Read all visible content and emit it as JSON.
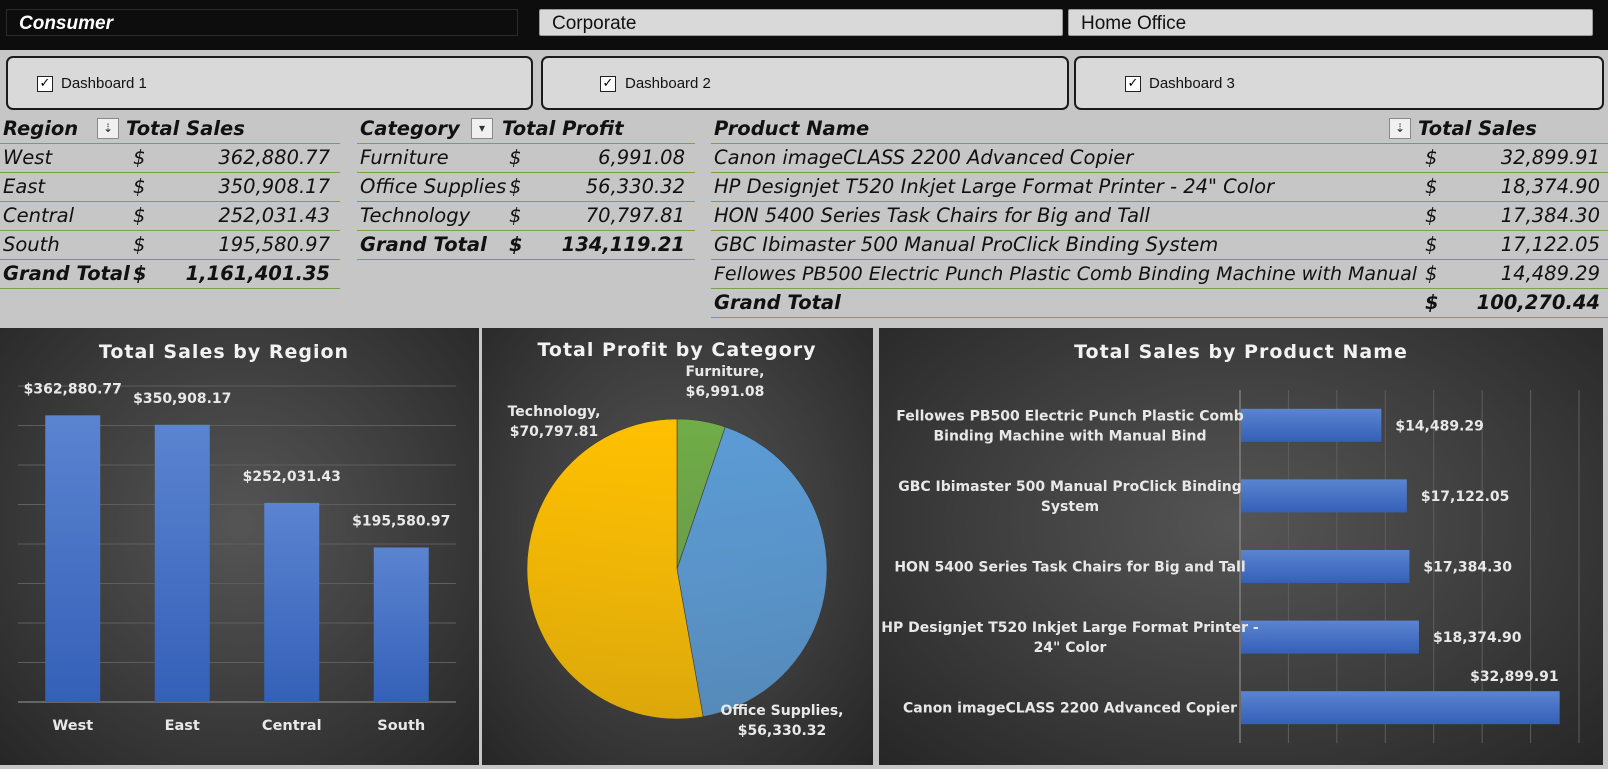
{
  "segments": [
    {
      "label": "Consumer",
      "active": true
    },
    {
      "label": "Corporate",
      "active": false
    },
    {
      "label": "Home Office",
      "active": false
    }
  ],
  "dashboards": [
    {
      "label": "Dashboard 1",
      "checked": true
    },
    {
      "label": "Dashboard 2",
      "checked": true
    },
    {
      "label": "Dashboard 3",
      "checked": true
    }
  ],
  "region_table": {
    "headers": [
      "Region",
      "Total Sales"
    ],
    "rows": [
      {
        "label": "West",
        "currency": "$",
        "value": "362,880.77"
      },
      {
        "label": "East",
        "currency": "$",
        "value": "350,908.17"
      },
      {
        "label": "Central",
        "currency": "$",
        "value": "252,031.43"
      },
      {
        "label": "South",
        "currency": "$",
        "value": "195,580.97"
      }
    ],
    "total": {
      "label": "Grand Total",
      "currency": "$",
      "value": "1,161,401.35"
    }
  },
  "category_table": {
    "headers": [
      "Category",
      "Total Profit"
    ],
    "rows": [
      {
        "label": "Furniture",
        "currency": "$",
        "value": "6,991.08"
      },
      {
        "label": "Office Supplies",
        "currency": "$",
        "value": "56,330.32"
      },
      {
        "label": "Technology",
        "currency": "$",
        "value": "70,797.81"
      }
    ],
    "total": {
      "label": "Grand Total",
      "currency": "$",
      "value": "134,119.21"
    }
  },
  "product_table": {
    "headers": [
      "Product Name",
      "Total Sales"
    ],
    "rows": [
      {
        "label": "Canon imageCLASS 2200 Advanced Copier",
        "currency": "$",
        "value": "32,899.91"
      },
      {
        "label": "HP Designjet T520 Inkjet Large Format Printer - 24\" Color",
        "currency": "$",
        "value": "18,374.90"
      },
      {
        "label": "HON 5400 Series Task Chairs for Big and Tall",
        "currency": "$",
        "value": "17,384.30"
      },
      {
        "label": "GBC Ibimaster 500 Manual ProClick Binding System",
        "currency": "$",
        "value": "17,122.05"
      },
      {
        "label": "Fellowes PB500 Electric Punch Plastic Comb Binding Machine with Manual",
        "currency": "$",
        "value": "14,489.29"
      }
    ],
    "total": {
      "label": "Grand Total",
      "currency": "$",
      "value": "100,270.44"
    }
  },
  "icons": {
    "sort_desc": "sort-descending-icon",
    "dropdown": "dropdown-arrow-icon",
    "filter_sort": "filter-sort-icon",
    "check": "checkmark-icon"
  },
  "colors": {
    "bar": "#4472c4",
    "furniture": "#70ad47",
    "office_supplies": "#5b9bd5",
    "technology": "#ffc000",
    "table_border": "#76a44a"
  },
  "chart_data": [
    {
      "type": "bar",
      "title": "Total Sales by Region",
      "categories": [
        "West",
        "East",
        "Central",
        "South"
      ],
      "values": [
        362880.77,
        350908.17,
        252031.43,
        195580.97
      ],
      "data_labels": [
        "$362,880.77",
        "$350,908.17",
        "$252,031.43",
        "$195,580.97"
      ],
      "ylim": [
        0,
        400000
      ],
      "grid": true,
      "legend": "none"
    },
    {
      "type": "pie",
      "title": "Total Profit by Category",
      "categories": [
        "Furniture",
        "Office Supplies",
        "Technology"
      ],
      "values": [
        6991.08,
        56330.32,
        70797.81
      ],
      "data_labels": [
        [
          "Furniture,",
          "$6,991.08"
        ],
        [
          "Office Supplies,",
          "$56,330.32"
        ],
        [
          "Technology,",
          "$70,797.81"
        ]
      ],
      "legend": "none"
    },
    {
      "type": "bar",
      "orientation": "horizontal",
      "title": "Total Sales by Product Name",
      "categories": [
        [
          "Fellowes PB500 Electric Punch Plastic Comb",
          "Binding Machine with Manual Bind"
        ],
        [
          "GBC Ibimaster 500 Manual ProClick Binding",
          "System"
        ],
        [
          "HON 5400 Series Task Chairs for Big and Tall"
        ],
        [
          "HP Designjet T520 Inkjet Large Format Printer -",
          "24\" Color"
        ],
        [
          "Canon imageCLASS 2200 Advanced Copier"
        ]
      ],
      "values": [
        14489.29,
        17122.05,
        17384.3,
        18374.9,
        32899.91
      ],
      "data_labels": [
        "$14,489.29",
        "$17,122.05",
        "$17,384.30",
        "$18,374.90",
        "$32,899.91"
      ],
      "xlim": [
        0,
        35000
      ],
      "grid": true,
      "legend": "none"
    }
  ]
}
